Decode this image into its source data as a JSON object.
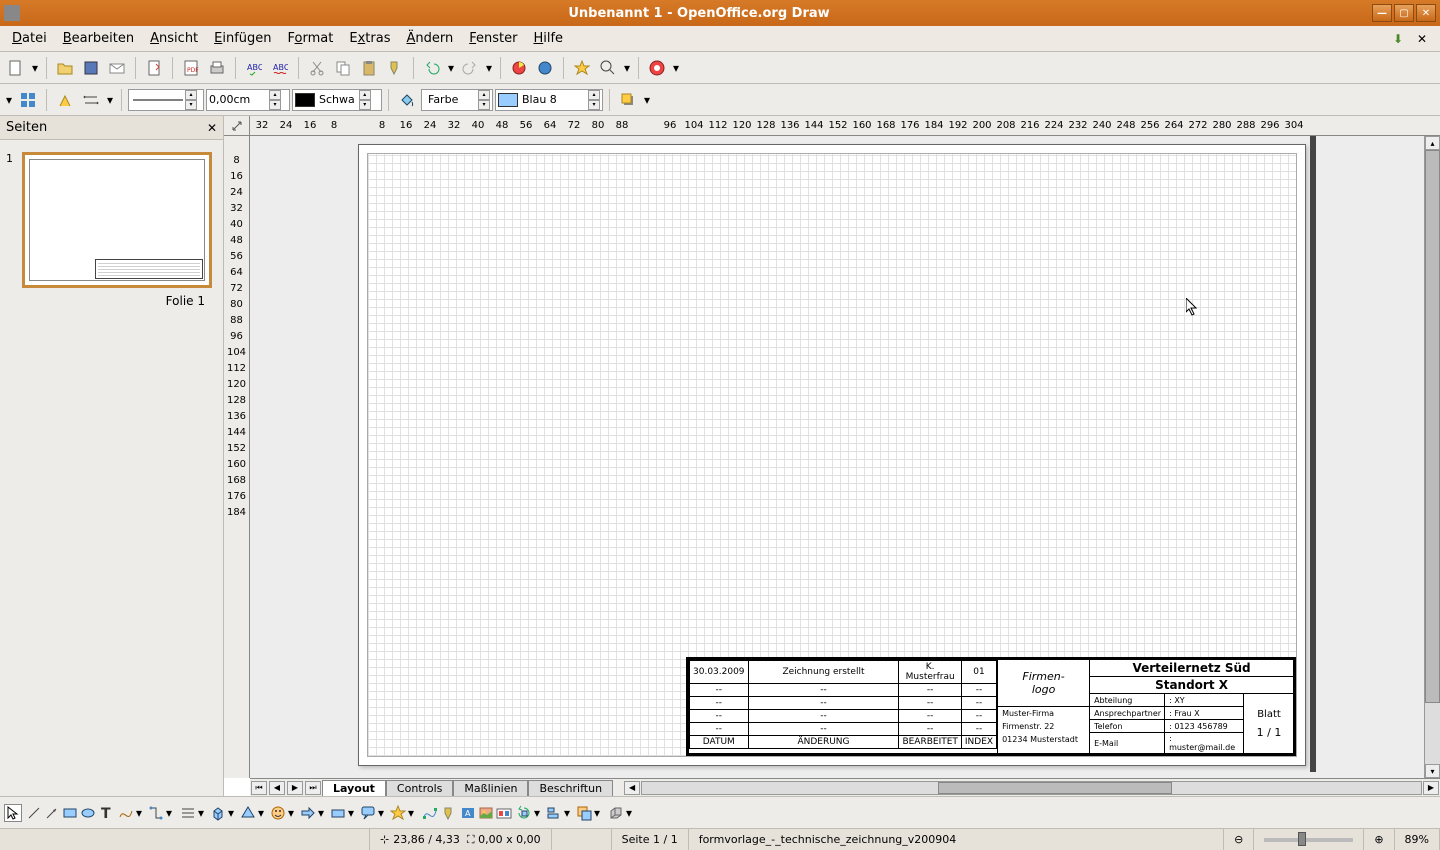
{
  "window": {
    "title": "Unbenannt 1 - OpenOffice.org Draw"
  },
  "menu": {
    "items": [
      "Datei",
      "Bearbeiten",
      "Ansicht",
      "Einfügen",
      "Format",
      "Extras",
      "Ändern",
      "Fenster",
      "Hilfe"
    ]
  },
  "format_toolbar": {
    "line_width": "0,00cm",
    "line_color_label": "Schwa",
    "fill_type": "Farbe",
    "fill_color_label": "Blau 8"
  },
  "sidebar": {
    "title": "Seiten",
    "slide_number": "1",
    "slide_label": "Folie 1"
  },
  "ruler_h": [
    "32",
    "24",
    "16",
    "8",
    "",
    "8",
    "16",
    "24",
    "32",
    "40",
    "48",
    "56",
    "64",
    "72",
    "80",
    "88",
    "",
    "96",
    "104",
    "112",
    "120",
    "128",
    "136",
    "144",
    "152",
    "160",
    "168",
    "176",
    "184",
    "192",
    "200",
    "208",
    "216",
    "224",
    "232",
    "240",
    "248",
    "256",
    "264",
    "272",
    "280",
    "288",
    "296",
    "304"
  ],
  "ruler_v": [
    "",
    "8",
    "16",
    "24",
    "32",
    "40",
    "48",
    "56",
    "64",
    "72",
    "80",
    "88",
    "96",
    "104",
    "112",
    "120",
    "128",
    "136",
    "144",
    "152",
    "160",
    "168",
    "176",
    "184"
  ],
  "title_block": {
    "revisions": [
      {
        "date": "30.03.2009",
        "change": "Zeichnung erstellt",
        "by": "K. Musterfrau",
        "idx": "01"
      },
      {
        "date": "--",
        "change": "--",
        "by": "--",
        "idx": "--"
      },
      {
        "date": "--",
        "change": "--",
        "by": "--",
        "idx": "--"
      },
      {
        "date": "--",
        "change": "--",
        "by": "--",
        "idx": "--"
      },
      {
        "date": "--",
        "change": "--",
        "by": "--",
        "idx": "--"
      }
    ],
    "header": {
      "date": "DATUM",
      "change": "ÄNDERUNG",
      "by": "BEARBEITET",
      "idx": "INDEX"
    },
    "logo": "Firmen-\nlogo",
    "drawing_title_1": "Verteilernetz Süd",
    "drawing_title_2": "Standort X",
    "company": {
      "name": "Muster-Firma",
      "street": "Firmenstr. 22",
      "city": "01234 Musterstadt"
    },
    "info": {
      "abteilung_lbl": "Abteilung",
      "abteilung": "XY",
      "ansprech_lbl": "Ansprechpartner",
      "ansprech": "Frau X",
      "telefon_lbl": "Telefon",
      "telefon": "0123 456789",
      "email_lbl": "E-Mail",
      "email": "muster@mail.de"
    },
    "blatt_lbl": "Blatt",
    "blatt": "1 / 1"
  },
  "tabs": {
    "items": [
      "Layout",
      "Controls",
      "Maßlinien",
      "Beschriftun"
    ],
    "active": 0
  },
  "status": {
    "coords": "23,86 / 4,33",
    "size": "0,00 x 0,00",
    "page": "Seite 1 / 1",
    "template": "formvorlage_-_technische_zeichnung_v200904",
    "zoom": "89%"
  }
}
